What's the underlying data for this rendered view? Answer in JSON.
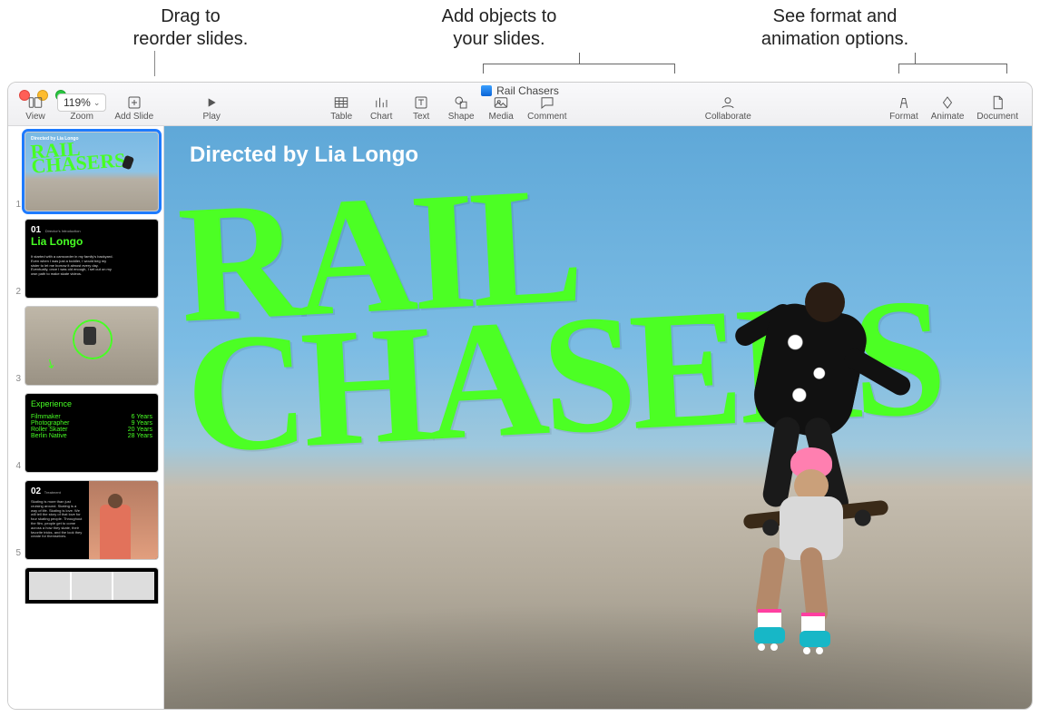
{
  "callouts": {
    "left": "Drag to\nreorder slides.",
    "center": "Add objects to\nyour slides.",
    "right": "See format and\nanimation options."
  },
  "window": {
    "documentTitle": "Rail Chasers"
  },
  "toolbar": {
    "view": "View",
    "zoomValue": "119%",
    "zoomLabel": "Zoom",
    "addSlide": "Add Slide",
    "play": "Play",
    "table": "Table",
    "chart": "Chart",
    "text": "Text",
    "shape": "Shape",
    "media": "Media",
    "comment": "Comment",
    "collaborate": "Collaborate",
    "format": "Format",
    "animate": "Animate",
    "document": "Document"
  },
  "navigator": {
    "slides": [
      {
        "num": "1"
      },
      {
        "num": "2",
        "title01": "01",
        "subtitle01": "Director's Introduction",
        "name": "Lia Longo",
        "para": "It started with a camcorder in my family's backyard. Even when I was just a toddler, I would beg my sister to let me borrow it almost every day. Eventually, once I was old enough, I set out on my own path to make skate videos."
      },
      {
        "num": "3"
      },
      {
        "num": "4",
        "header": "Experience",
        "rows": [
          {
            "l": "Filmmaker",
            "r": "6 Years"
          },
          {
            "l": "Photographer",
            "r": "9 Years"
          },
          {
            "l": "Roller Skater",
            "r": "20 Years"
          },
          {
            "l": "Berlin Native",
            "r": "28 Years"
          }
        ]
      },
      {
        "num": "5",
        "title02": "02",
        "subtitle02": "Treatment",
        "para5": "Skating is more than just cruising around. Skating is a way of life. Skating is love. We will tell the story of that love for four skating people. Throughout the film, people get to come across a how they skate, their favorite tricks, and the look they create for themselves."
      },
      {
        "num": ""
      }
    ]
  },
  "slide": {
    "directed": "Directed by Lia Longo",
    "railLine1": "RAIL",
    "railLine2": "CHASERS"
  }
}
